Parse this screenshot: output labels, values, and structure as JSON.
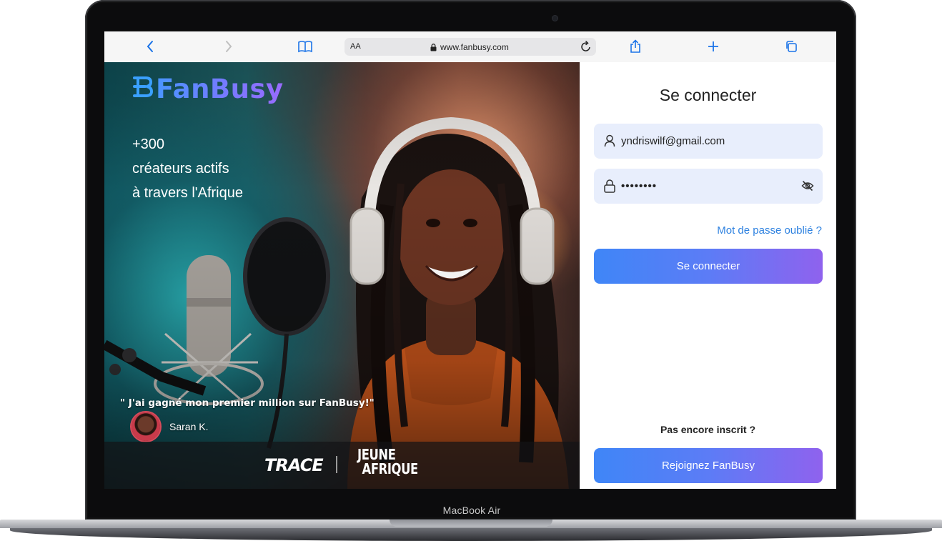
{
  "device": {
    "model_label": "MacBook Air"
  },
  "browser": {
    "reader_label": "AA",
    "url": "www.fanbusy.com",
    "accent_color": "#1a73e8"
  },
  "hero": {
    "brand": "FanBusy",
    "stats": [
      "+300",
      "créateurs actifs",
      "à travers l'Afrique"
    ],
    "quote": "\" J'ai gagné mon premier million sur FanBusy!\"",
    "author": "Saran K.",
    "partners": {
      "trace": "TRACE",
      "ja_line1": "JEUNE",
      "ja_line2": "AFRIQUE"
    }
  },
  "login": {
    "title": "Se connecter",
    "email_value": "yndriswilf@gmail.com",
    "password_value": "••••••••",
    "forgot_label": "Mot de passe oublié ?",
    "submit_label": "Se connecter",
    "signup_question": "Pas encore inscrit ?",
    "signup_label": "Rejoignez FanBusy",
    "button_gradient": [
      "#3f86f7",
      "#8f62ee"
    ],
    "field_background": "#e8eefc",
    "link_color": "#2f82e0"
  },
  "icons": [
    "back-icon",
    "forward-icon",
    "bookmarks-icon",
    "lock-icon",
    "reload-icon",
    "share-icon",
    "plus-icon",
    "tabs-icon",
    "user-icon",
    "padlock-icon",
    "eye-off-icon"
  ]
}
